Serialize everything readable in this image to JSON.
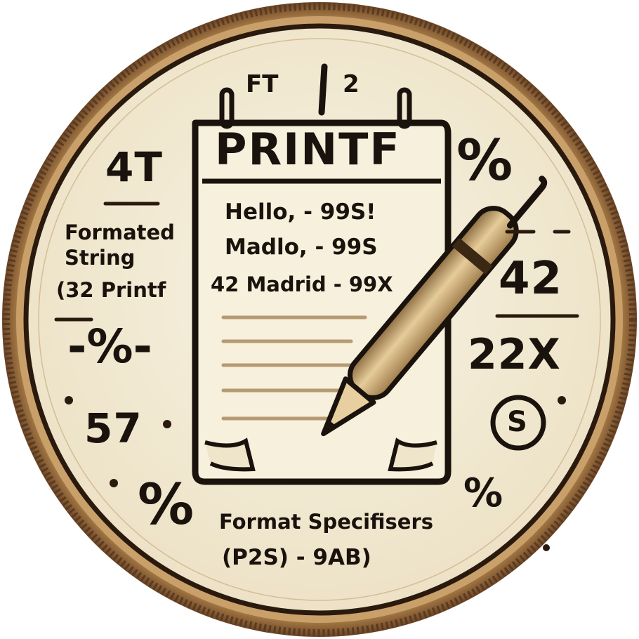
{
  "emblem": {
    "top_tag": "FT",
    "top_num": "2",
    "notepad_title": "PRINTF",
    "notepad_lines": [
      "Hello, - 99S!",
      "Madlo, - 99S",
      "42 Madrid - 99X"
    ],
    "left_num_top": "4T",
    "left_caption": [
      "Formated",
      "String",
      "(32 Printf"
    ],
    "left_percent": "-%-",
    "left_num_bottom": "57",
    "bottom_left_percent": "%",
    "bottom_caption": "Format Specifisers",
    "bottom_caption_sub": "(P2S) - 9AB)",
    "right_percent_top": "%",
    "right_num_1": "42",
    "right_num_2": "22X",
    "right_symbol": "S",
    "bottom_right_percent": "%"
  },
  "colors": {
    "coin_rim": "#5a3a20",
    "coin_gold": "#c9a36a",
    "coin_face": "#f3ecd8",
    "ink": "#1a120c",
    "pen_body": "#d9bb86"
  }
}
